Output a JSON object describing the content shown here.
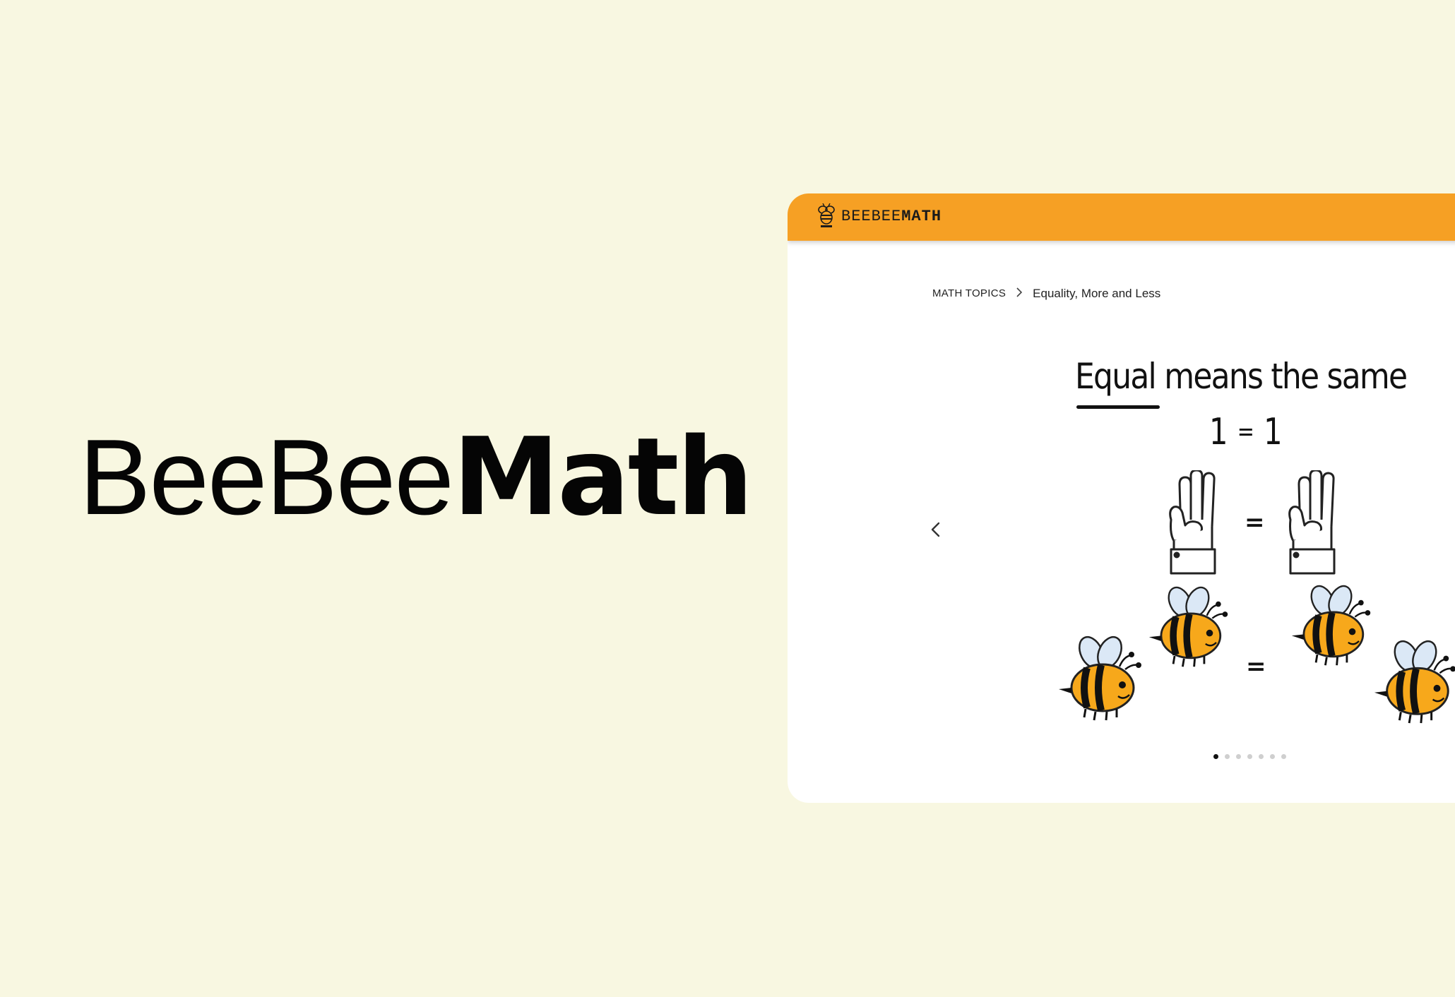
{
  "hero": {
    "title_light": "BeeBee",
    "title_bold": "Math"
  },
  "browser": {
    "header": {
      "logo_icon": "bee-logo-icon",
      "logo_light": "BEEBEE",
      "logo_bold": "MATH",
      "bar_color": "#f6a024"
    },
    "breadcrumb": {
      "root": "MATH TOPICS",
      "separator_icon": "chevron-right-icon",
      "current": "Equality, More and Less"
    },
    "slide": {
      "title_word": "Equal",
      "title_rest": " means the same",
      "equation_left": "1",
      "equation_op": "=",
      "equation_right": "1",
      "hands_equals": "=",
      "bees_equals": "=",
      "hand_icon": "hand-three-fingers-icon",
      "bee_icon": "bee-illustration"
    },
    "carousel": {
      "prev_icon": "chevron-left-icon",
      "total_slides": 7,
      "active_slide": 1
    }
  },
  "colors": {
    "page_background": "#f8f7e1",
    "accent": "#f6a024",
    "bee_yellow": "#f7a81b",
    "wing_blue": "#dbe8f6"
  }
}
